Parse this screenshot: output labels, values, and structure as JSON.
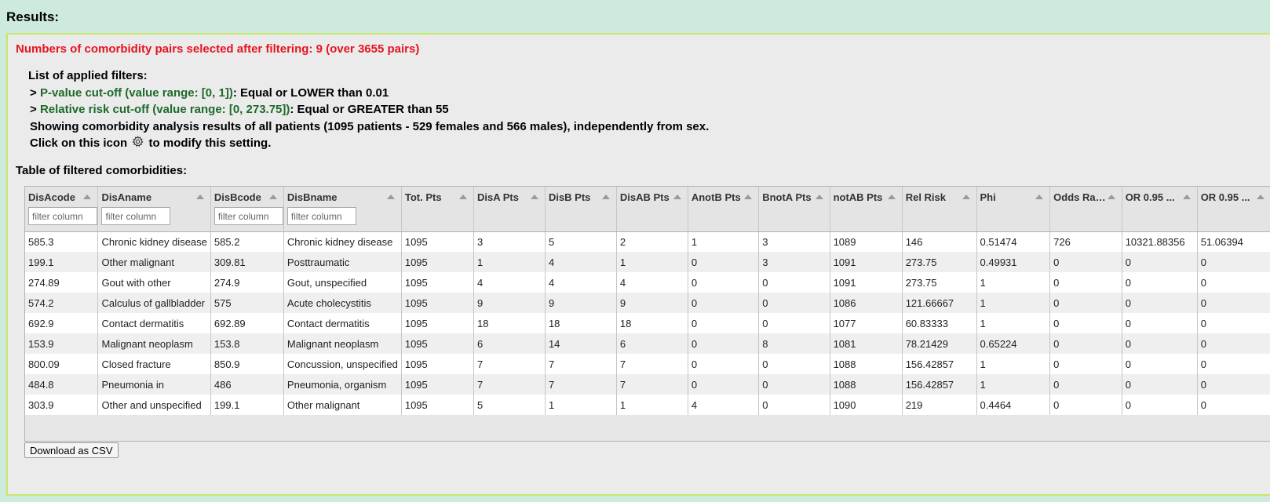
{
  "results_title": "Results:",
  "count_line": "Numbers of comorbidity pairs selected after filtering: 9 (over 3655 pairs)",
  "filters": {
    "heading": "List of applied filters:",
    "items": [
      {
        "prefix": "> ",
        "name": "P-value cut-off (value range: [0, 1])",
        "rest": ": Equal or LOWER than 0.01"
      },
      {
        "prefix": "> ",
        "name": "Relative risk cut-off (value range: [0, 273.75])",
        "rest": ": Equal or GREATER than 55"
      }
    ],
    "showing": "Showing comorbidity analysis results of all patients (1095 patients - 529 females and 566 males), independently from sex.",
    "click_before": "Click on this icon",
    "click_after": "to modify this setting."
  },
  "table_title": "Table of filtered comorbidities:",
  "filter_placeholder": "filter column",
  "columns": [
    "DisAcode",
    "DisAname",
    "DisBcode",
    "DisBname",
    "Tot. Pts",
    "DisA Pts",
    "DisB Pts",
    "DisAB Pts",
    "AnotB Pts",
    "BnotA Pts",
    "notAB Pts",
    "Rel Risk",
    "Phi",
    "Odds Ratio",
    "OR 0.95 ...",
    "OR 0.95 ..."
  ],
  "filterable_columns": 4,
  "rows": [
    [
      "585.3",
      "Chronic kidney disease",
      "585.2",
      "Chronic kidney disease",
      "1095",
      "3",
      "5",
      "2",
      "1",
      "3",
      "1089",
      "146",
      "0.51474",
      "726",
      "10321.88356",
      "51.06394"
    ],
    [
      "199.1",
      "Other malignant",
      "309.81",
      "Posttraumatic",
      "1095",
      "1",
      "4",
      "1",
      "0",
      "3",
      "1091",
      "273.75",
      "0.49931",
      "0",
      "0",
      "0"
    ],
    [
      "274.89",
      "Gout with other",
      "274.9",
      "Gout, unspecified",
      "1095",
      "4",
      "4",
      "4",
      "0",
      "0",
      "1091",
      "273.75",
      "1",
      "0",
      "0",
      "0"
    ],
    [
      "574.2",
      "Calculus of gallbladder",
      "575",
      "Acute cholecystitis",
      "1095",
      "9",
      "9",
      "9",
      "0",
      "0",
      "1086",
      "121.66667",
      "1",
      "0",
      "0",
      "0"
    ],
    [
      "692.9",
      "Contact dermatitis",
      "692.89",
      "Contact dermatitis",
      "1095",
      "18",
      "18",
      "18",
      "0",
      "0",
      "1077",
      "60.83333",
      "1",
      "0",
      "0",
      "0"
    ],
    [
      "153.9",
      "Malignant neoplasm",
      "153.8",
      "Malignant neoplasm",
      "1095",
      "6",
      "14",
      "6",
      "0",
      "8",
      "1081",
      "78.21429",
      "0.65224",
      "0",
      "0",
      "0"
    ],
    [
      "800.09",
      "Closed fracture",
      "850.9",
      "Concussion, unspecified",
      "1095",
      "7",
      "7",
      "7",
      "0",
      "0",
      "1088",
      "156.42857",
      "1",
      "0",
      "0",
      "0"
    ],
    [
      "484.8",
      "Pneumonia in",
      "486",
      "Pneumonia, organism",
      "1095",
      "7",
      "7",
      "7",
      "0",
      "0",
      "1088",
      "156.42857",
      "1",
      "0",
      "0",
      "0"
    ],
    [
      "303.9",
      "Other and unspecified",
      "199.1",
      "Other malignant",
      "1095",
      "5",
      "1",
      "1",
      "4",
      "0",
      "1090",
      "219",
      "0.4464",
      "0",
      "0",
      "0"
    ]
  ],
  "download_button": "Download as CSV",
  "colors": {
    "page_bg": "#cdeadd",
    "panel_bg": "#ebebeb",
    "panel_border": "#c8e86a",
    "count_red": "#e8131f",
    "filter_green": "#1d6a2a"
  }
}
